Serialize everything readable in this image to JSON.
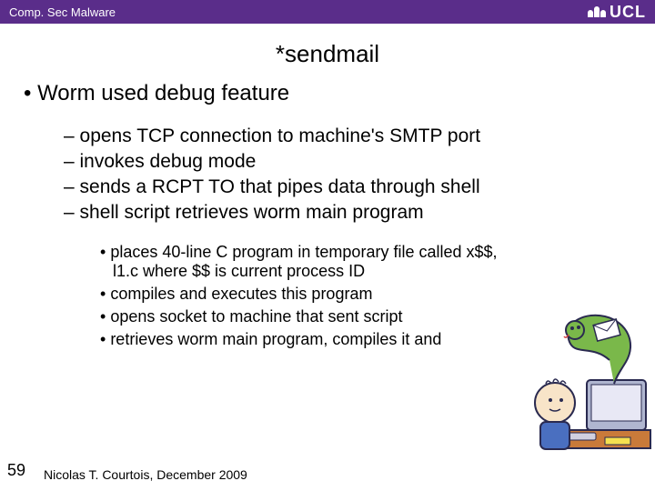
{
  "header": {
    "crumb": "Comp. Sec Malware",
    "logo_text": "UCL"
  },
  "slide": {
    "title": "*sendmail",
    "bullet1": "Worm used debug feature",
    "level2": [
      "opens TCP connection to machine's SMTP port",
      "invokes debug mode",
      "sends a RCPT TO that pipes data through shell",
      "shell script retrieves worm main program"
    ],
    "level3": [
      "places 40-line C program in temporary file called x$$, l1.c where $$ is current process ID",
      "compiles and executes this program",
      "opens socket to machine that sent script",
      "retrieves worm main program, compiles it and"
    ]
  },
  "footer": {
    "page": "59",
    "author": "Nicolas T. Courtois, December 2009"
  }
}
